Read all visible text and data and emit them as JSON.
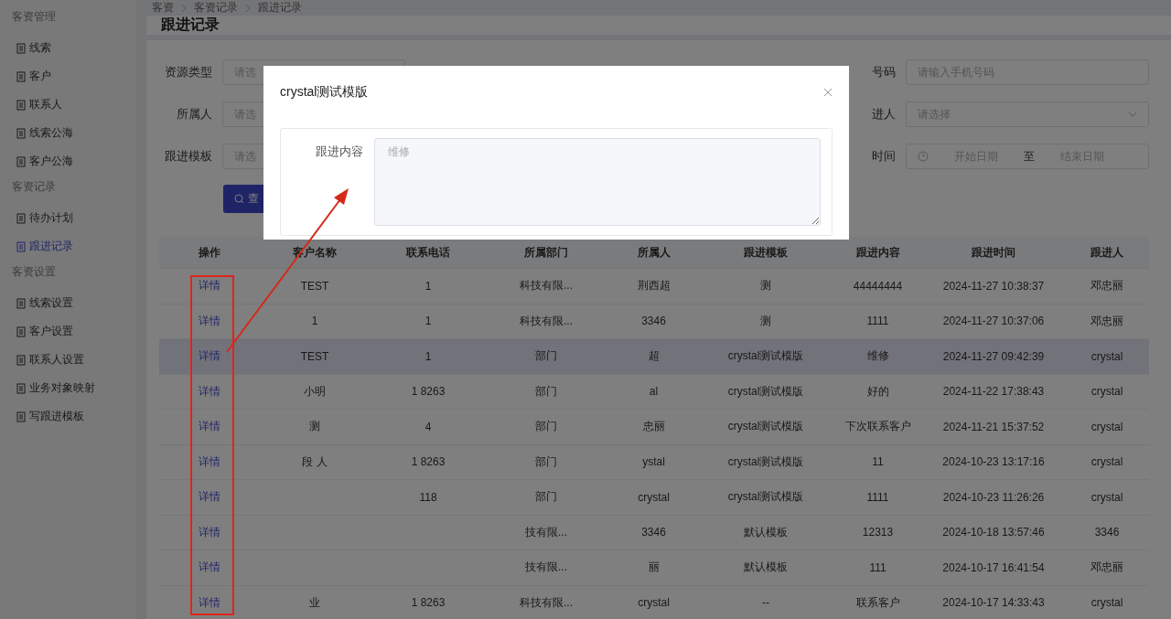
{
  "sidebar": {
    "groups": [
      {
        "title": "客资管理",
        "items": [
          {
            "label": "线索",
            "selected": false
          },
          {
            "label": "客户",
            "selected": false
          },
          {
            "label": "联系人",
            "selected": false
          },
          {
            "label": "线索公海",
            "selected": false
          },
          {
            "label": "客户公海",
            "selected": false
          }
        ]
      },
      {
        "title": "客资记录",
        "items": [
          {
            "label": "待办计划",
            "selected": false
          },
          {
            "label": "跟进记录",
            "selected": true
          }
        ]
      },
      {
        "title": "客资设置",
        "items": [
          {
            "label": "线索设置",
            "selected": false
          },
          {
            "label": "客户设置",
            "selected": false
          },
          {
            "label": "联系人设置",
            "selected": false
          },
          {
            "label": "业务对象映射",
            "selected": false
          },
          {
            "label": "写跟进模板",
            "selected": false
          }
        ]
      }
    ]
  },
  "breadcrumb": [
    "客资",
    "客资记录",
    "跟进记录"
  ],
  "page_title": "跟进记录",
  "filters": {
    "left": [
      {
        "label": "资源类型",
        "placeholder": "请选"
      },
      {
        "label": "所属人",
        "placeholder": "请选"
      },
      {
        "label": "跟进模板",
        "placeholder": "请选"
      }
    ],
    "right": [
      {
        "kind": "input",
        "label": "号码",
        "placeholder": "请输入手机号码"
      },
      {
        "kind": "select",
        "label": "进人",
        "placeholder": "请选择"
      },
      {
        "kind": "daterange",
        "label": "时间",
        "start": "开始日期",
        "separator": "至",
        "end": "结束日期"
      }
    ],
    "search_button": "查"
  },
  "table": {
    "columns": [
      "操作",
      "客户名称",
      "联系电话",
      "所属部门",
      "所属人",
      "跟进模板",
      "跟进内容",
      "跟进时间",
      "跟进人"
    ],
    "rows": [
      {
        "selected": false,
        "cells": [
          "详情",
          "TEST",
          "1",
          "科技有限...",
          "荆西超",
          "测",
          "44444444",
          "2024-11-27 10:38:37",
          "邓忠丽"
        ]
      },
      {
        "selected": false,
        "cells": [
          "详情",
          "1",
          "1",
          "科技有限...",
          "3346",
          "测",
          "1111",
          "2024-11-27 10:37:06",
          "邓忠丽"
        ]
      },
      {
        "selected": true,
        "cells": [
          "详情",
          "TEST",
          "1",
          "部门",
          "超",
          "crystal测试模版",
          "维修",
          "2024-11-27 09:42:39",
          "crystal"
        ]
      },
      {
        "selected": false,
        "cells": [
          "详情",
          "小明",
          "1 8263",
          "部门",
          "al",
          "crystal测试模版",
          "好的",
          "2024-11-22 17:38:43",
          "crystal"
        ]
      },
      {
        "selected": false,
        "cells": [
          "详情",
          "测",
          "4",
          "部门",
          "忠丽",
          "crystal测试模版",
          "下次联系客户",
          "2024-11-21 15:37:52",
          "crystal"
        ]
      },
      {
        "selected": false,
        "cells": [
          "详情",
          "段 人",
          "1 8263",
          "部门",
          "ystal",
          "crystal测试模版",
          "11",
          "2024-10-23 13:17:16",
          "crystal"
        ]
      },
      {
        "selected": false,
        "cells": [
          "详情",
          "",
          "118",
          "部门",
          "crystal",
          "crystal测试模版",
          "1111",
          "2024-10-23 11:26:26",
          "crystal"
        ]
      },
      {
        "selected": false,
        "cells": [
          "详情",
          "",
          "",
          "技有限...",
          "3346",
          "默认模板",
          "12313",
          "2024-10-18 13:57:46",
          "3346"
        ]
      },
      {
        "selected": false,
        "cells": [
          "详情",
          "",
          "",
          "技有限...",
          "丽",
          "默认模板",
          "111",
          "2024-10-17 16:41:54",
          "邓忠丽"
        ]
      },
      {
        "selected": false,
        "cells": [
          "详情",
          "业",
          "1 8263",
          "科技有限...",
          "crystal",
          "--",
          "联系客户",
          "2024-10-17 14:33:43",
          "crystal"
        ]
      }
    ]
  },
  "dialog": {
    "title": "crystal测试模版",
    "field_label": "跟进内容",
    "field_value": "维修"
  }
}
